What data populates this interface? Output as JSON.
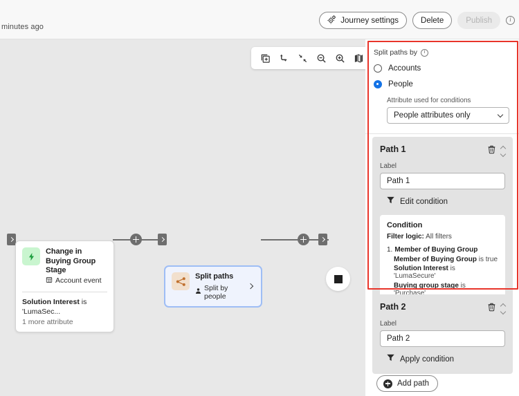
{
  "topbar": {
    "subtitle": "minutes ago",
    "journey_settings_label": "Journey settings",
    "delete_label": "Delete",
    "publish_label": "Publish"
  },
  "canvas": {
    "toolbar": [
      {
        "name": "duplicate-icon"
      },
      {
        "name": "redo-icon"
      },
      {
        "name": "fit-to-screen-icon"
      },
      {
        "name": "zoom-out-icon"
      },
      {
        "name": "zoom-in-icon"
      },
      {
        "name": "minimap-icon"
      }
    ],
    "event_node": {
      "title": "Change in Buying Group Stage",
      "subtitle": "Account event",
      "attribute_bold": "Solution Interest",
      "attribute_rest": " is 'LumaSec...",
      "more_attributes": "1 more attribute"
    },
    "split_node": {
      "title": "Split paths",
      "subtitle": "Split by people"
    }
  },
  "panel": {
    "split_paths_by_label": "Split paths by",
    "options": [
      {
        "label": "Accounts",
        "selected": false
      },
      {
        "label": "People",
        "selected": true
      }
    ],
    "attribute_field_label": "Attribute used for conditions",
    "attribute_value": "People attributes only",
    "paths": [
      {
        "title": "Path 1",
        "label_caption": "Label",
        "label_value": "Path 1",
        "condition_action": "Edit condition",
        "condition": {
          "heading": "Condition",
          "filter_logic_label": "Filter logic:",
          "filter_logic_value": "All filters",
          "items": [
            {
              "number": "1.",
              "name": "Member of Buying Group",
              "lines": [
                {
                  "bold": "Member of Buying Group",
                  "rest": " is true"
                },
                {
                  "bold": "Solution Interest",
                  "rest": " is 'LumaSecure'"
                },
                {
                  "bold": "Buying group stage",
                  "rest": " is 'Purchase'"
                }
              ]
            }
          ]
        }
      },
      {
        "title": "Path 2",
        "label_caption": "Label",
        "label_value": "Path 2",
        "condition_action": "Apply condition",
        "condition": null
      }
    ],
    "add_path_label": "Add path"
  },
  "colors": {
    "accent_blue": "#1473e6",
    "highlight_red": "#e8342a",
    "event_badge": "#c9f5cf",
    "split_badge": "#f2e0cd"
  }
}
